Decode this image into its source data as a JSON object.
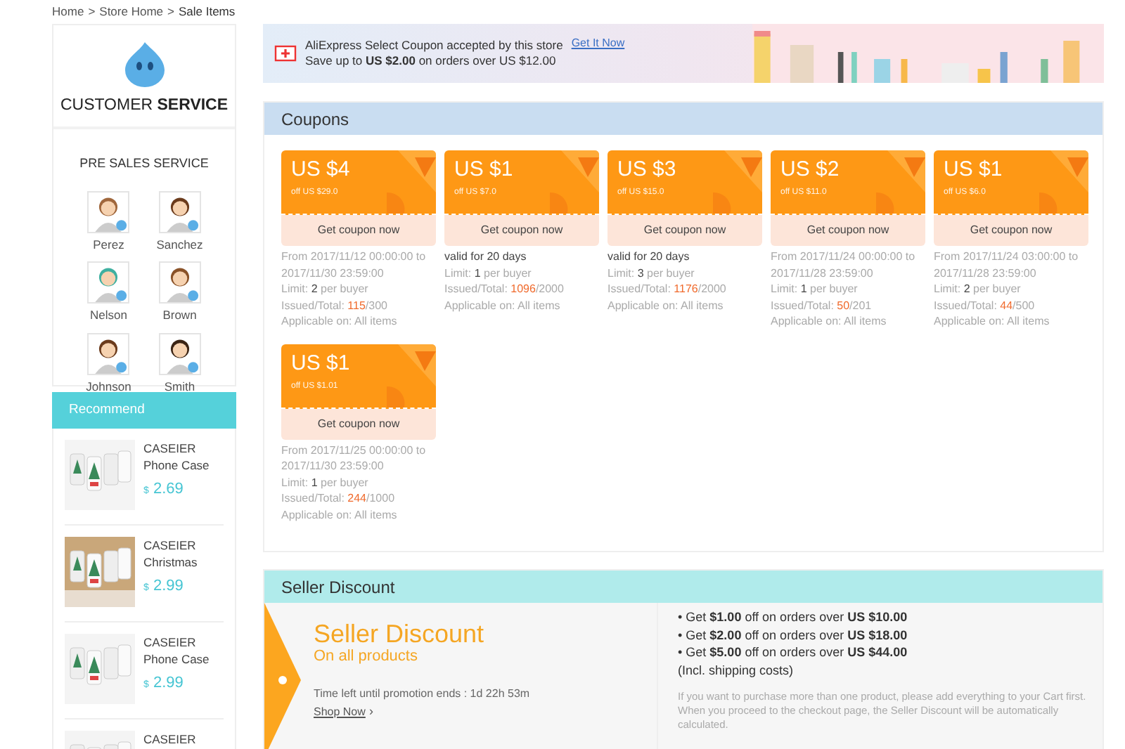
{
  "breadcrumb": [
    "Home",
    "Store Home",
    "Sale Items"
  ],
  "breadcrumb_separator": ">",
  "customer_service": {
    "title_light": "CUSTOMER",
    "title_bold": "SERVICE",
    "section": "PRE SALES SERVICE",
    "agents": [
      {
        "name": "Perez"
      },
      {
        "name": "Sanchez"
      },
      {
        "name": "Nelson"
      },
      {
        "name": "Brown"
      },
      {
        "name": "Johnson"
      },
      {
        "name": "Smith"
      }
    ]
  },
  "recommend": {
    "title": "Recommend",
    "items": [
      {
        "name": "CASEIER Phone Case",
        "currency": "$",
        "price": "2.69"
      },
      {
        "name": "CASEIER Christmas",
        "currency": "$",
        "price": "2.99"
      },
      {
        "name": "CASEIER Phone Case",
        "currency": "$",
        "price": "2.99"
      },
      {
        "name": "CASEIER"
      }
    ]
  },
  "promo_banner": {
    "title": "AliExpress Select Coupon accepted by this store",
    "text": "Save up to **US $2.00** on orders over US $12.00",
    "link": "Get It Now"
  },
  "coupons": {
    "title": "Coupons",
    "items": [
      {
        "amount": "US $4",
        "condition": "off US $29.0",
        "button": "Get coupon now",
        "highlighted": false,
        "validity": "From 2017/11/12 00:00:00 to 2017/11/30 23:59:00",
        "limit": "Limit: **2** per buyer",
        "issued_label": "Issued/Total:",
        "issued": "115",
        "total": "/300",
        "applicable": "Applicable on: All items"
      },
      {
        "amount": "US $1",
        "condition": "off US $7.0",
        "button": "Get coupon now",
        "highlighted": true,
        "validity": "valid for 20 days",
        "limit": "Limit: **1** per buyer",
        "issued_label": "Issued/Total:",
        "issued": "1096",
        "total": "/2000",
        "applicable": "Applicable on: All items"
      },
      {
        "amount": "US $3",
        "condition": "off US $15.0",
        "button": "Get coupon now",
        "highlighted": true,
        "validity": "valid for 20 days",
        "limit": "Limit: **3** per buyer",
        "issued_label": "Issued/Total:",
        "issued": "1176",
        "total": "/2000",
        "applicable": "Applicable on: All items"
      },
      {
        "amount": "US $2",
        "condition": "off US $11.0",
        "button": "Get coupon now",
        "highlighted": false,
        "validity": "From 2017/11/24 00:00:00 to 2017/11/28 23:59:00",
        "limit": "Limit: **1** per buyer",
        "issued_label": "Issued/Total:",
        "issued": "50",
        "total": "/201",
        "applicable": "Applicable on: All items"
      },
      {
        "amount": "US $1",
        "condition": "off US $6.0",
        "button": "Get coupon now",
        "highlighted": false,
        "validity": "From 2017/11/24 03:00:00 to 2017/11/28 23:59:00",
        "limit": "Limit: **2** per buyer",
        "issued_label": "Issued/Total:",
        "issued": "44",
        "total": "/500",
        "applicable": "Applicable on: All items"
      },
      {
        "amount": "US $1",
        "condition": "off US $1.01",
        "button": "Get coupon now",
        "highlighted": false,
        "validity": "From 2017/11/25 00:00:00 to 2017/11/30 23:59:00",
        "limit": "Limit: **1** per buyer",
        "issued_label": "Issued/Total:",
        "issued": "244",
        "total": "/1000",
        "applicable": "Applicable on: All items"
      }
    ]
  },
  "seller_discount": {
    "title": "Seller Discount",
    "heading": "Seller Discount",
    "subheading": "On all products",
    "time_left_label": "Time left until promotion ends :",
    "time_left": "1d 22h 53m",
    "link": "Shop Now",
    "link_arrow": "›",
    "rules": [
      {
        "bullet": "•",
        "text": "Get **$1.00** off on orders over **US $10.00**"
      },
      {
        "bullet": "•",
        "text": "Get **$2.00** off on orders over **US $18.00**"
      },
      {
        "bullet": "•",
        "text": "Get **$5.00** off on orders over **US $44.00**"
      }
    ],
    "shipping_note": "(Incl. shipping costs)",
    "note": "If you want to purchase more than one product, please add everything to your Cart first. When you proceed to the checkout page, the Seller Discount will be automatically calculated."
  }
}
